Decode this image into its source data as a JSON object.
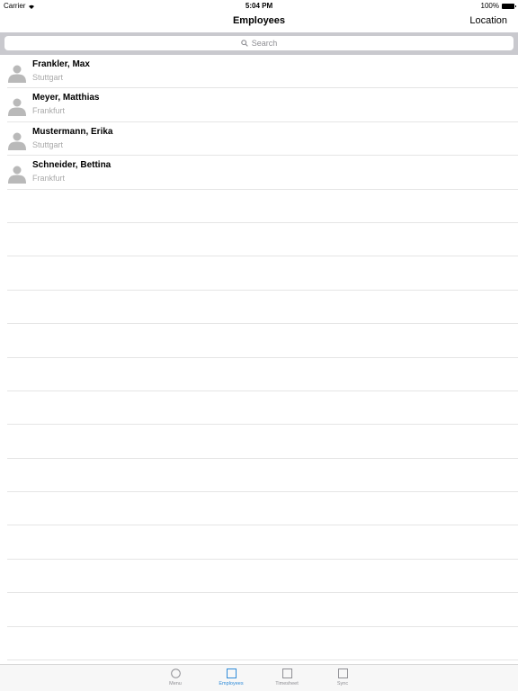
{
  "status": {
    "carrier": "Carrier",
    "time": "5:04 PM",
    "battery": "100%"
  },
  "nav": {
    "title": "Employees",
    "right_button": "Location"
  },
  "search": {
    "placeholder": "Search"
  },
  "employees": [
    {
      "name": "Frankler, Max",
      "city": "Stuttgart"
    },
    {
      "name": "Meyer, Matthias",
      "city": "Frankfurt"
    },
    {
      "name": "Mustermann, Erika",
      "city": "Stuttgart"
    },
    {
      "name": "Schneider, Bettina",
      "city": "Frankfurt"
    }
  ],
  "tabs": [
    {
      "label": "Menu",
      "icon": "circle-icon",
      "active": false
    },
    {
      "label": "Employees",
      "icon": "square-icon",
      "active": true
    },
    {
      "label": "Timesheet",
      "icon": "square-icon",
      "active": false
    },
    {
      "label": "Sync",
      "icon": "square-icon",
      "active": false
    }
  ],
  "colors": {
    "accent": "#2f8bd8",
    "search_bar_bg": "#c9c9ce",
    "secondary_text": "#a9a9a9"
  }
}
